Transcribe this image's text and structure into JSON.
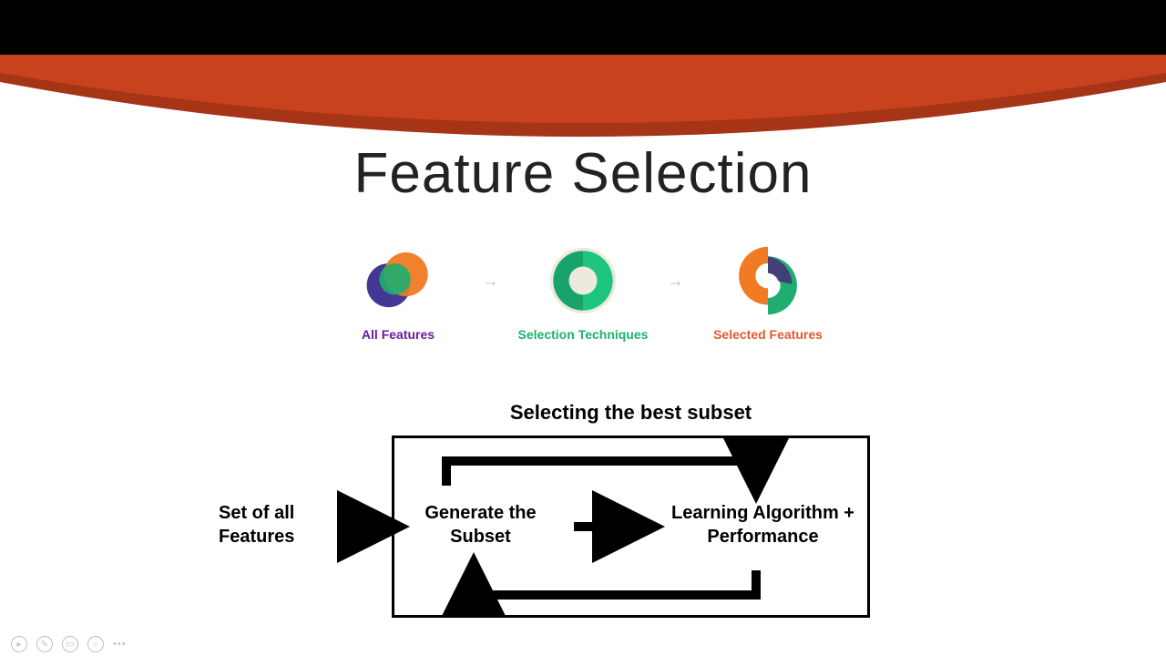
{
  "title": "Feature Selection",
  "icons": {
    "items": [
      {
        "label": "All Features"
      },
      {
        "label": "Selection Techniques"
      },
      {
        "label": "Selected Features"
      }
    ]
  },
  "diagram": {
    "title": "Selecting the best subset",
    "left_label": "Set of all Features",
    "generate_label": "Generate the Subset",
    "learning_label": "Learning Algorithm + Performance"
  },
  "colors": {
    "banner": "#c9421e",
    "banner_dark": "#a63417"
  }
}
